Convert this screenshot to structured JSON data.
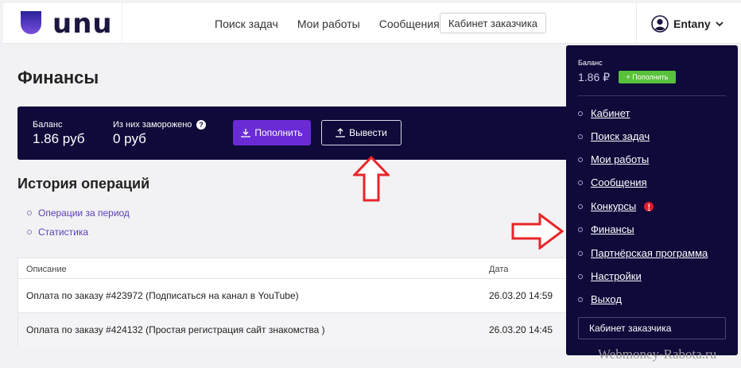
{
  "header": {
    "logo_text": "unu",
    "nav": [
      "Поиск задач",
      "Мои работы",
      "Сообщения"
    ],
    "client_cabinet": "Кабинет заказчика",
    "username": "Entany"
  },
  "finance": {
    "title": "Финансы",
    "balance_label": "Баланс",
    "balance_value": "1.86 руб",
    "frozen_label": "Из них заморожено",
    "frozen_value": "0 руб",
    "help_glyph": "?",
    "topup_button": "Пополнить",
    "withdraw_button": "Вывести"
  },
  "history": {
    "title": "История операций",
    "links": [
      "Операции за период",
      "Статистика"
    ],
    "columns": [
      "Описание",
      "Дата"
    ],
    "rows": [
      {
        "description": "Оплата по заказу #423972 (Подписаться на канал в YouTube)",
        "date": "26.03.20 14:59"
      },
      {
        "description": "Оплата по заказу #424132 (Простая регистрация сайт знакомства )",
        "date": "26.03.20 14:45"
      }
    ]
  },
  "dropdown": {
    "balance_label": "Баланс",
    "balance_value": "1.86 ₽",
    "topup_label": "+ Пополнить",
    "items": [
      "Кабинет",
      "Поиск задач",
      "Мои работы",
      "Сообщения",
      "Конкурсы",
      "Финансы",
      "Партнёрская программа",
      "Настройки",
      "Выход"
    ],
    "alert_glyph": "!",
    "client_cabinet": "Кабинет заказчика"
  },
  "watermark": "Webmoney-Rabota.ru",
  "colors": {
    "panel": "#0e0a3a",
    "accent_purple": "#6a2bd6",
    "topup_green": "#59c13b",
    "arrow_red": "#e8262a"
  }
}
